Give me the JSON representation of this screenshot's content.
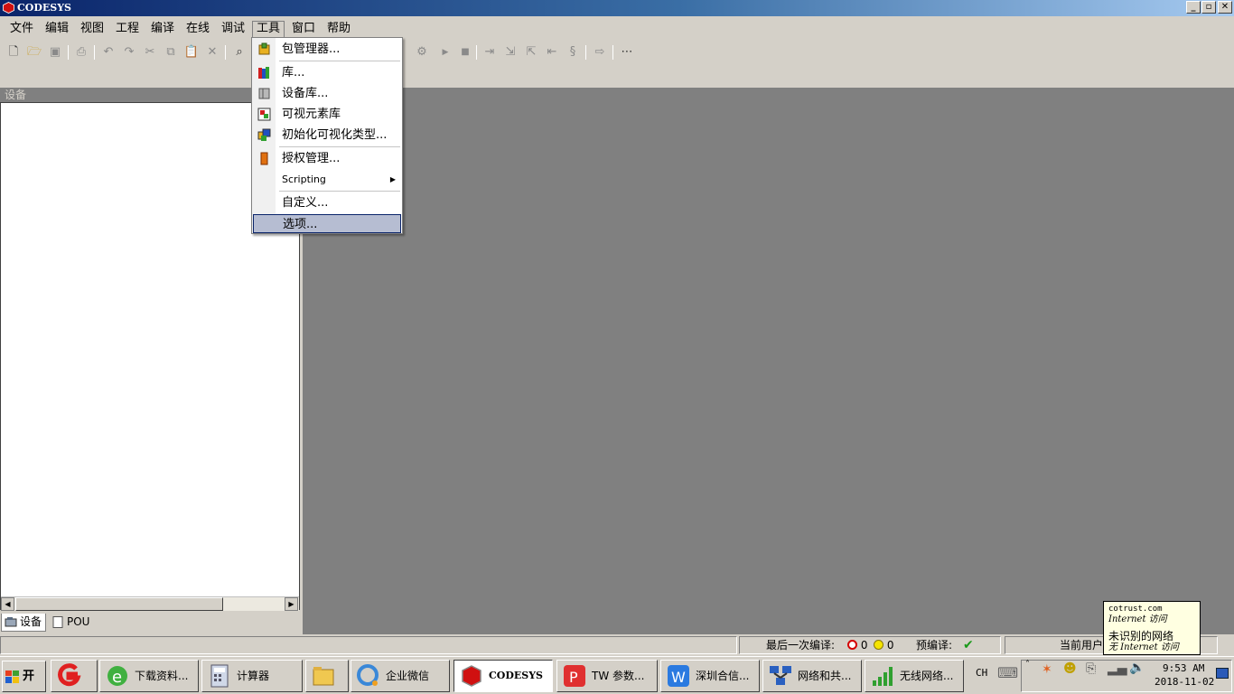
{
  "window": {
    "title": "CODESYS"
  },
  "menubar": {
    "items": [
      "文件",
      "编辑",
      "视图",
      "工程",
      "编译",
      "在线",
      "调试",
      "工具",
      "窗口",
      "帮助"
    ],
    "active": "工具"
  },
  "tools_menu": {
    "items": [
      {
        "label": "包管理器...",
        "icon": "package-icon"
      },
      {
        "label": "库...",
        "icon": "library-icon"
      },
      {
        "label": "设备库...",
        "icon": "device-repository-icon"
      },
      {
        "label": "可视元素库",
        "icon": "visual-element-icon"
      },
      {
        "label": "初始化可视化类型...",
        "icon": "visualization-type-icon"
      },
      {
        "label": "授权管理...",
        "icon": "license-icon"
      },
      {
        "label": "Scripting",
        "icon": "",
        "submenu": true
      },
      {
        "label": "自定义...",
        "icon": ""
      },
      {
        "label": "选项...",
        "icon": "",
        "highlighted": true
      }
    ]
  },
  "left_pane": {
    "header": "设备",
    "tabs": [
      {
        "label": "设备",
        "active": true
      },
      {
        "label": "POU",
        "active": false
      }
    ]
  },
  "statusbar": {
    "last_build_label": "最后一次编译:",
    "errors": "0",
    "warnings": "0",
    "precompile_label": "预编译:",
    "precompile_ok": "✔",
    "current_user_label": "当前用户"
  },
  "tooltip": {
    "line1": "cotrust.com",
    "line2": "Internet 访问",
    "line3": "未识别的网络",
    "line4": "无 Internet 访问"
  },
  "taskbar": {
    "start_label": "开始",
    "tasks": [
      {
        "label": "",
        "icon": "tencent-g-icon"
      },
      {
        "label": "下载资料...",
        "icon": "ie-icon"
      },
      {
        "label": "计算器",
        "icon": "calculator-icon"
      },
      {
        "label": "",
        "icon": "explorer-folder-icon"
      },
      {
        "label": "企业微信",
        "icon": "wecom-icon"
      },
      {
        "label": "CODESYS",
        "icon": "codesys-icon",
        "active": true
      },
      {
        "label": "TW 参数...",
        "icon": "wps-pdf-icon"
      },
      {
        "label": "深圳合信...",
        "icon": "wps-writer-icon"
      },
      {
        "label": "网络和共...",
        "icon": "network-center-icon"
      },
      {
        "label": "无线网络...",
        "icon": "wireless-icon"
      }
    ],
    "lang": "CH",
    "time": "9:53 AM",
    "date": "2018-11-02"
  },
  "colors": {
    "menu_highlight": "#b6bdd2",
    "workspace": "#808080",
    "error": "#d40000",
    "ok_green": "#1a9a1a"
  }
}
